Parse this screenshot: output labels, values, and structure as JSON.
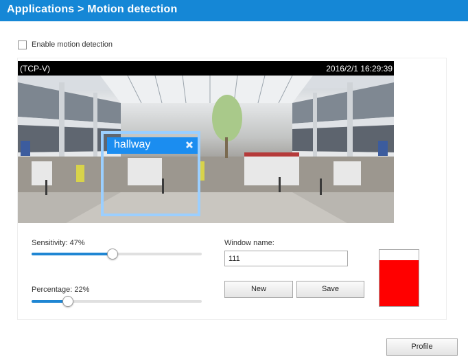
{
  "header": {
    "title": "Applications > Motion detection"
  },
  "enable": {
    "label": "Enable motion detection",
    "checked": false
  },
  "video": {
    "camera_name": "(TCP-V)",
    "timestamp": "2016/2/1 16:29:39"
  },
  "window": {
    "name": "hallway",
    "close_icon": "close-icon"
  },
  "sensitivity": {
    "label": "Sensitivity: 47%",
    "value": 47
  },
  "percentage": {
    "label": "Percentage: 22%",
    "value": 22
  },
  "window_name": {
    "label": "Window  name:",
    "value": "111"
  },
  "buttons": {
    "new": "New",
    "save": "Save",
    "profile": "Profile"
  },
  "activity_meter": {
    "level": 0.82,
    "color": "#ff0000"
  },
  "colors": {
    "accent": "#1587d6",
    "window_header": "#1b8df0",
    "window_border": "#9bcfff"
  }
}
